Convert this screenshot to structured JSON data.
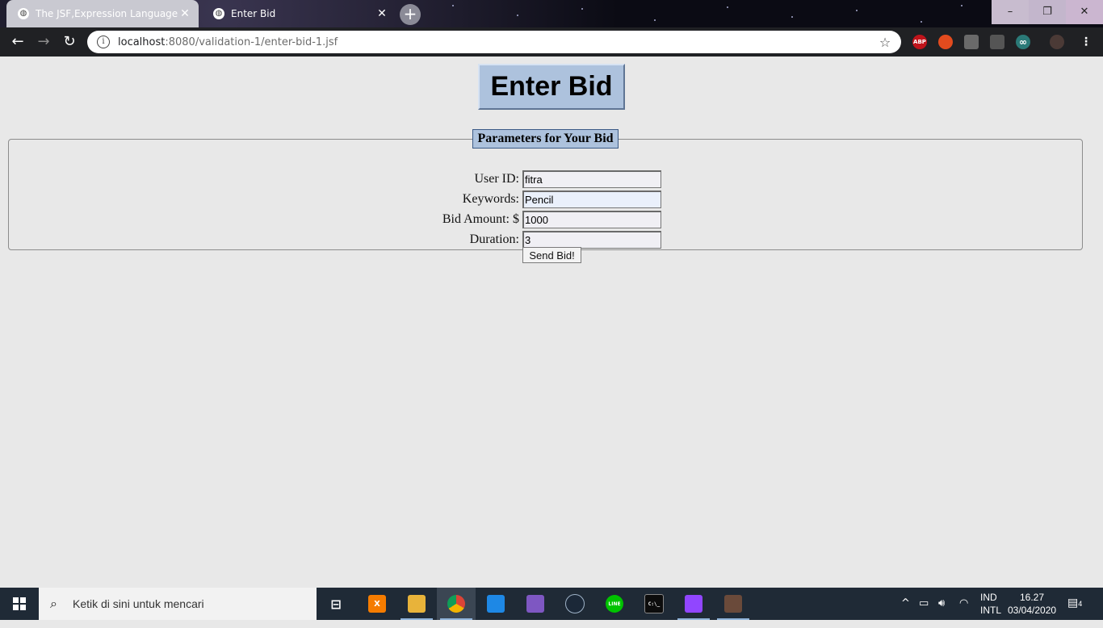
{
  "browser": {
    "tabs": [
      {
        "title": "The JSF,Expression Language",
        "active": false
      },
      {
        "title": "Enter Bid",
        "active": true
      }
    ],
    "new_tab_label": "+",
    "window_controls": {
      "minimize": "–",
      "maximize": "❐",
      "close": "✕"
    },
    "nav": {
      "back": "←",
      "forward": "→",
      "reload": "↻"
    },
    "address": {
      "host": "localhost",
      "path": ":8080/validation-1/enter-bid-1.jsf"
    },
    "extensions": [
      {
        "name": "adblock-plus-icon",
        "label": "ABP",
        "color": "#c0141b"
      },
      {
        "name": "reddit-enhancement-icon",
        "label": "",
        "color": "#e34b1e"
      },
      {
        "name": "extension-icon",
        "label": "",
        "color": "#6a6a6a"
      },
      {
        "name": "cast-icon",
        "label": "",
        "color": "#555555"
      },
      {
        "name": "infinity-icon",
        "label": "∞",
        "color": "#2b7a78"
      }
    ]
  },
  "page": {
    "title": "Enter Bid",
    "fieldset_legend": "Parameters for Your Bid",
    "fields": [
      {
        "label": "User ID:",
        "value": "fitra"
      },
      {
        "label": "Keywords:",
        "value": "Pencil"
      },
      {
        "label": "Bid Amount: $",
        "value": "1000"
      },
      {
        "label": "Duration:",
        "value": "3"
      }
    ],
    "submit_label": "Send Bid!"
  },
  "taskbar": {
    "search_placeholder": "Ketik di sini untuk mencari",
    "apps": [
      {
        "name": "task-view-icon",
        "label": "",
        "color": "#1f2a36",
        "active": false
      },
      {
        "name": "xampp-icon",
        "label": "X",
        "color": "#f57c00",
        "active": false
      },
      {
        "name": "file-explorer-icon",
        "label": "",
        "color": "#e8b33a",
        "active": false
      },
      {
        "name": "chrome-icon",
        "label": "",
        "color": "#db4437",
        "active": true
      },
      {
        "name": "vscode-icon",
        "label": "",
        "color": "#1e88e5",
        "active": false
      },
      {
        "name": "visual-studio-icon",
        "label": "",
        "color": "#7e57c2",
        "active": false
      },
      {
        "name": "steam-icon",
        "label": "",
        "color": "#1b2838",
        "active": false
      },
      {
        "name": "line-icon",
        "label": "LINE",
        "color": "#00c300",
        "active": false
      },
      {
        "name": "terminal-icon",
        "label": "C:\\_",
        "color": "#0c0c0c",
        "active": false
      },
      {
        "name": "twitch-icon",
        "label": "",
        "color": "#9146ff",
        "active": false
      },
      {
        "name": "game-icon",
        "label": "",
        "color": "#6a4a3a",
        "active": false
      }
    ],
    "language": {
      "line1": "IND",
      "line2": "INTL"
    },
    "clock": {
      "time": "16.27",
      "date": "03/04/2020"
    },
    "notification_count": "4"
  }
}
